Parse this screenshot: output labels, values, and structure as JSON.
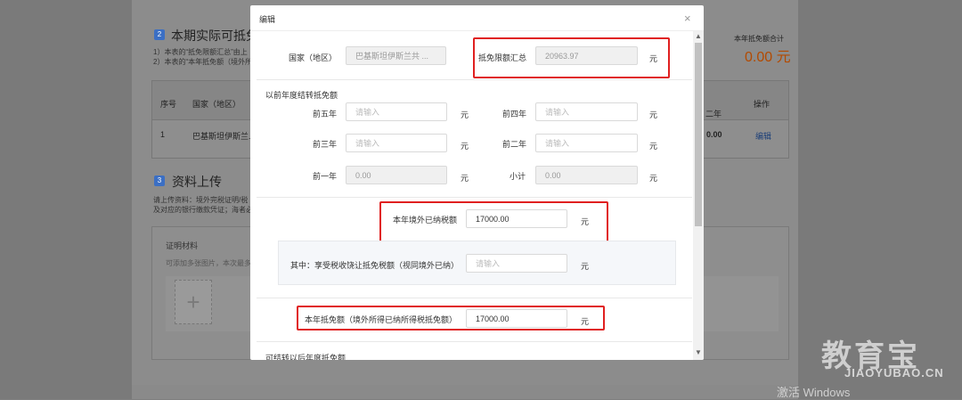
{
  "background": {
    "section2": {
      "badge": "2",
      "title": "本期实际可抵免",
      "note1": "1）本表的“抵免限额汇总”由上",
      "note2": "2）本表的“本年抵免额（境外所"
    },
    "total": {
      "label": "本年抵免额合计",
      "value": "0.00",
      "unit": "元"
    },
    "table": {
      "headers": [
        "序号",
        "国家（地区）",
        "二年",
        "操作"
      ],
      "row": {
        "index": "1",
        "country": "巴基斯坦伊斯兰...",
        "value": "0.00",
        "action": "编辑"
      }
    },
    "section3": {
      "badge": "3",
      "title": "资料上传",
      "note1": "请上传资料：境外完税证明/税",
      "note2": "及对应的银行缴款凭证；海者必"
    },
    "upload": {
      "title": "证明材料",
      "hint": "可添加多张图片，本次最多",
      "plus": "+"
    }
  },
  "watermark": {
    "main": "教育宝",
    "sub": "JIAOYUBAO.CN",
    "windows": "激活 Windows"
  },
  "dialog": {
    "title": "编辑",
    "close": "×",
    "country_label": "国家（地区）",
    "country_value": "巴基斯坦伊斯兰共 ...",
    "limit_label": "抵免限额汇总",
    "limit_value": "20963.97",
    "unit": "元",
    "carry_section": "以前年度结转抵免额",
    "carry_items": {
      "y5": {
        "label": "前五年",
        "placeholder": "请输入"
      },
      "y4": {
        "label": "前四年",
        "placeholder": "请输入"
      },
      "y3": {
        "label": "前三年",
        "placeholder": "请输入"
      },
      "y2": {
        "label": "前二年",
        "placeholder": "请输入"
      },
      "y1": {
        "label": "前一年",
        "value": "0.00"
      },
      "subtotal": {
        "label": "小计",
        "value": "0.00"
      }
    },
    "paid_label": "本年境外已纳税额",
    "paid_value": "17000.00",
    "exempt_label": "其中：享受税收饶让抵免税额（视同境外已纳）",
    "exempt_placeholder": "请输入",
    "credit_label": "本年抵免额（境外所得已纳所得税抵免额）",
    "credit_value": "17000.00",
    "future_label": "可结转以后年度抵免额"
  }
}
